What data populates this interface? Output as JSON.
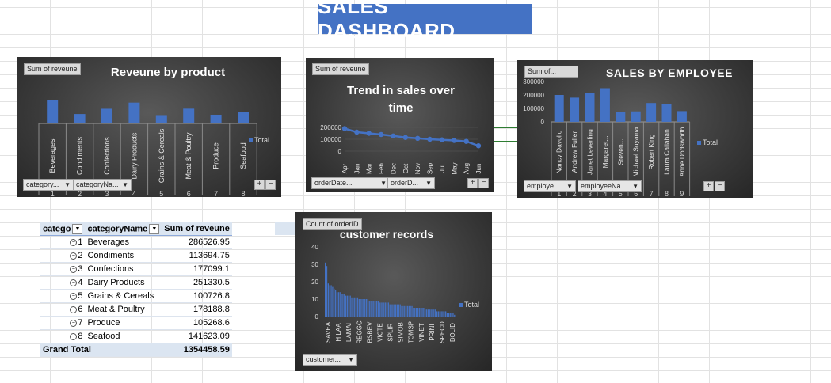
{
  "dashboard": {
    "title": "SALES  DASHBOARD"
  },
  "revenue_chart": {
    "title": "Reveune by product",
    "value_field": "Sum of reveune",
    "axis_buttons": [
      "category...",
      "categoryNa..."
    ],
    "legend": "Total",
    "category_ids": [
      "1",
      "2",
      "3",
      "4",
      "5",
      "6",
      "7",
      "8"
    ]
  },
  "trend_chart": {
    "title_line1": "Trend in sales over",
    "title_line2": "time",
    "value_field": "Sum of reveune",
    "axis_buttons": [
      "orderDate...",
      "orderD..."
    ],
    "plus": "+",
    "minus": "−"
  },
  "employee_chart": {
    "title": "SALES BY EMPLOYEE",
    "value_field": "Sum of...",
    "axis_buttons": [
      "employe...",
      "employeeNa..."
    ],
    "legend": "Total",
    "employee_ids": [
      "1",
      "2",
      "3",
      "4",
      "5",
      "6",
      "7",
      "8",
      "9"
    ],
    "plus": "+",
    "minus": "−"
  },
  "customer_chart": {
    "title": "customer records",
    "value_field": "Count of orderID",
    "axis_button": "customer...",
    "legend": "Total"
  },
  "revenue_controls": {
    "plus": "+",
    "minus": "−"
  },
  "pivot": {
    "headers": [
      "catego",
      "categoryName",
      "Sum of reveune"
    ],
    "rows": [
      {
        "id": "1",
        "name": "Beverages",
        "value": "286526.95"
      },
      {
        "id": "2",
        "name": "Condiments",
        "value": "113694.75"
      },
      {
        "id": "3",
        "name": "Confections",
        "value": "177099.1"
      },
      {
        "id": "4",
        "name": "Dairy Products",
        "value": "251330.5"
      },
      {
        "id": "5",
        "name": "Grains & Cereals",
        "value": "100726.8"
      },
      {
        "id": "6",
        "name": "Meat & Poultry",
        "value": "178188.8"
      },
      {
        "id": "7",
        "name": "Produce",
        "value": "105268.6"
      },
      {
        "id": "8",
        "name": "Seafood",
        "value": "141623.09"
      }
    ],
    "total_label": "Grand Total",
    "total_value": "1354458.59"
  },
  "chart_data": [
    {
      "type": "bar",
      "title": "Reveune by product",
      "categories": [
        "Beverages",
        "Condiments",
        "Confections",
        "Dairy Products",
        "Grains & Cereals",
        "Meat & Poultry",
        "Produce",
        "Seafood"
      ],
      "series": [
        {
          "name": "Total",
          "values": [
            286526.95,
            113694.75,
            177099.1,
            251330.5,
            100726.8,
            178188.8,
            105268.6,
            141623.09
          ]
        }
      ],
      "ylim": [
        0,
        300000
      ],
      "legend": "right"
    },
    {
      "type": "line",
      "title": "Trend in sales over time",
      "categories": [
        "Apr",
        "Jan",
        "Mar",
        "Feb",
        "Dec",
        "Oct",
        "Nov",
        "Sep",
        "Jul",
        "May",
        "Aug",
        "Jun"
      ],
      "series": [
        {
          "values": [
            190000,
            160000,
            150000,
            140000,
            128000,
            115000,
            108000,
            100000,
            95000,
            90000,
            82000,
            45000
          ]
        }
      ],
      "yticks": [
        0,
        100000,
        200000
      ],
      "ylim": [
        0,
        240000
      ]
    },
    {
      "type": "bar",
      "title": "SALES BY EMPLOYEE",
      "categories": [
        "Nancy Davolio",
        "Andrew Fuller",
        "Janet Leverling",
        "Margaret...",
        "Steven...",
        "Michael Suyama",
        "Robert King",
        "Laura Callahan",
        "Anne Dodsworth"
      ],
      "series": [
        {
          "name": "Total",
          "values": [
            200000,
            180000,
            215000,
            250000,
            75000,
            78000,
            140000,
            135000,
            80000
          ]
        }
      ],
      "yticks": [
        0,
        100000,
        200000,
        300000
      ],
      "ylim": [
        0,
        300000
      ],
      "legend": "right"
    },
    {
      "type": "bar",
      "title": "customer records",
      "visible_labels": [
        "SAVEA",
        "HILAA",
        "LAMAI",
        "REGGC",
        "BSBEV",
        "VICTE",
        "SPLIR",
        "SIMOB",
        "TOMSP",
        "VINET",
        "PRINI",
        "SPECD",
        "BOLID"
      ],
      "series": [
        {
          "name": "Total",
          "values": [
            31,
            29,
            19,
            18,
            18,
            17,
            16,
            15,
            14,
            14,
            14,
            13,
            13,
            13,
            12,
            12,
            12,
            12,
            11,
            11,
            11,
            11,
            11,
            10,
            10,
            10,
            10,
            10,
            10,
            10,
            9,
            9,
            9,
            9,
            9,
            9,
            9,
            8,
            8,
            8,
            8,
            8,
            8,
            8,
            7,
            7,
            7,
            7,
            7,
            7,
            7,
            7,
            6,
            6,
            6,
            6,
            6,
            6,
            6,
            6,
            5,
            5,
            5,
            5,
            5,
            5,
            5,
            5,
            4,
            4,
            4,
            4,
            4,
            4,
            4,
            4,
            3,
            3,
            3,
            3,
            3,
            3,
            3,
            2,
            2,
            2,
            2,
            2,
            1
          ]
        }
      ],
      "yticks": [
        0,
        10,
        20,
        30,
        40
      ],
      "ylim": [
        0,
        40
      ],
      "legend": "right"
    }
  ]
}
